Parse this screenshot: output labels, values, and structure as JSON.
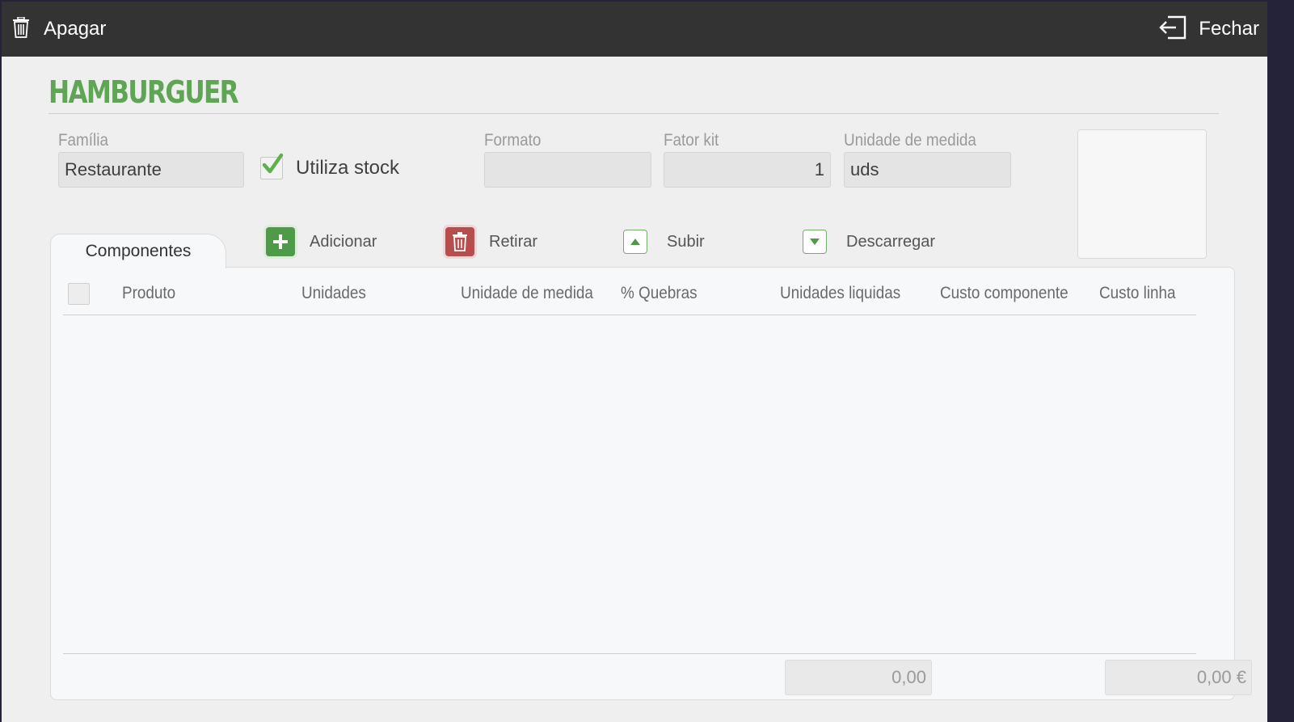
{
  "topbar": {
    "delete_label": "Apagar",
    "close_label": "Fechar"
  },
  "product": {
    "title": "HAMBURGUER"
  },
  "fields": {
    "familia": {
      "label": "Família",
      "value": "Restaurante"
    },
    "utiliza_stock": {
      "label": "Utiliza stock",
      "checked": true
    },
    "formato": {
      "label": "Formato",
      "value": ""
    },
    "fator_kit": {
      "label": "Fator kit",
      "value": "1"
    },
    "unidade_medida": {
      "label": "Unidade de medida",
      "value": "uds"
    }
  },
  "tabs": [
    {
      "label": "Componentes",
      "active": true
    }
  ],
  "toolbar": {
    "add_label": "Adicionar",
    "remove_label": "Retirar",
    "up_label": "Subir",
    "down_label": "Descarregar"
  },
  "table": {
    "columns": [
      "Produto",
      "Unidades",
      "Unidade de medida",
      "% Quebras",
      "Unidades liquidas",
      "Custo componente",
      "Custo linha"
    ],
    "rows": []
  },
  "totals": {
    "units_total": "0,00",
    "cost_total": "0,00 €"
  },
  "colors": {
    "title_green": "#5ea654",
    "add_green": "#4e9a48",
    "remove_red": "#b74d4d",
    "topbar_bg": "#333333"
  },
  "icons": {
    "delete": "trash-icon",
    "close": "exit-icon",
    "check": "check-icon",
    "add": "plus-icon",
    "remove": "trash-icon",
    "up": "arrow-up-icon",
    "down": "arrow-down-icon"
  }
}
